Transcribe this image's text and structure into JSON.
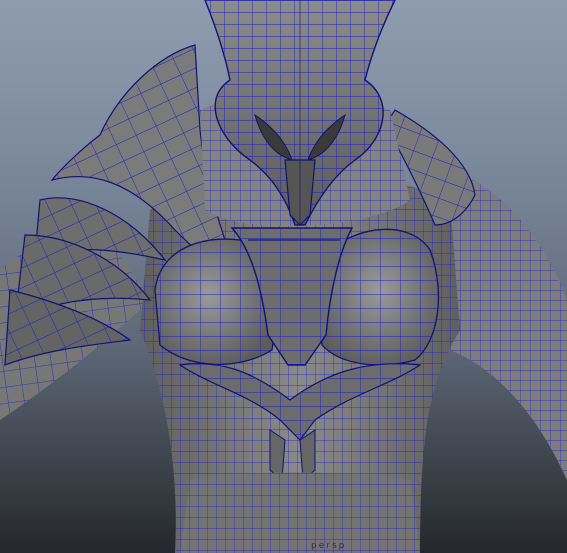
{
  "viewport": {
    "name": "3d-modeling-viewport",
    "display_mode": "wireframe-on-shaded",
    "background_gradient": [
      "#8f9cb0",
      "#7d8a9e",
      "#5e6878",
      "#3a3f47",
      "#24272c"
    ],
    "mesh_fill_color": "#7e7e7e",
    "wire_color": "#1c1cc8",
    "hud_text": "persp"
  }
}
